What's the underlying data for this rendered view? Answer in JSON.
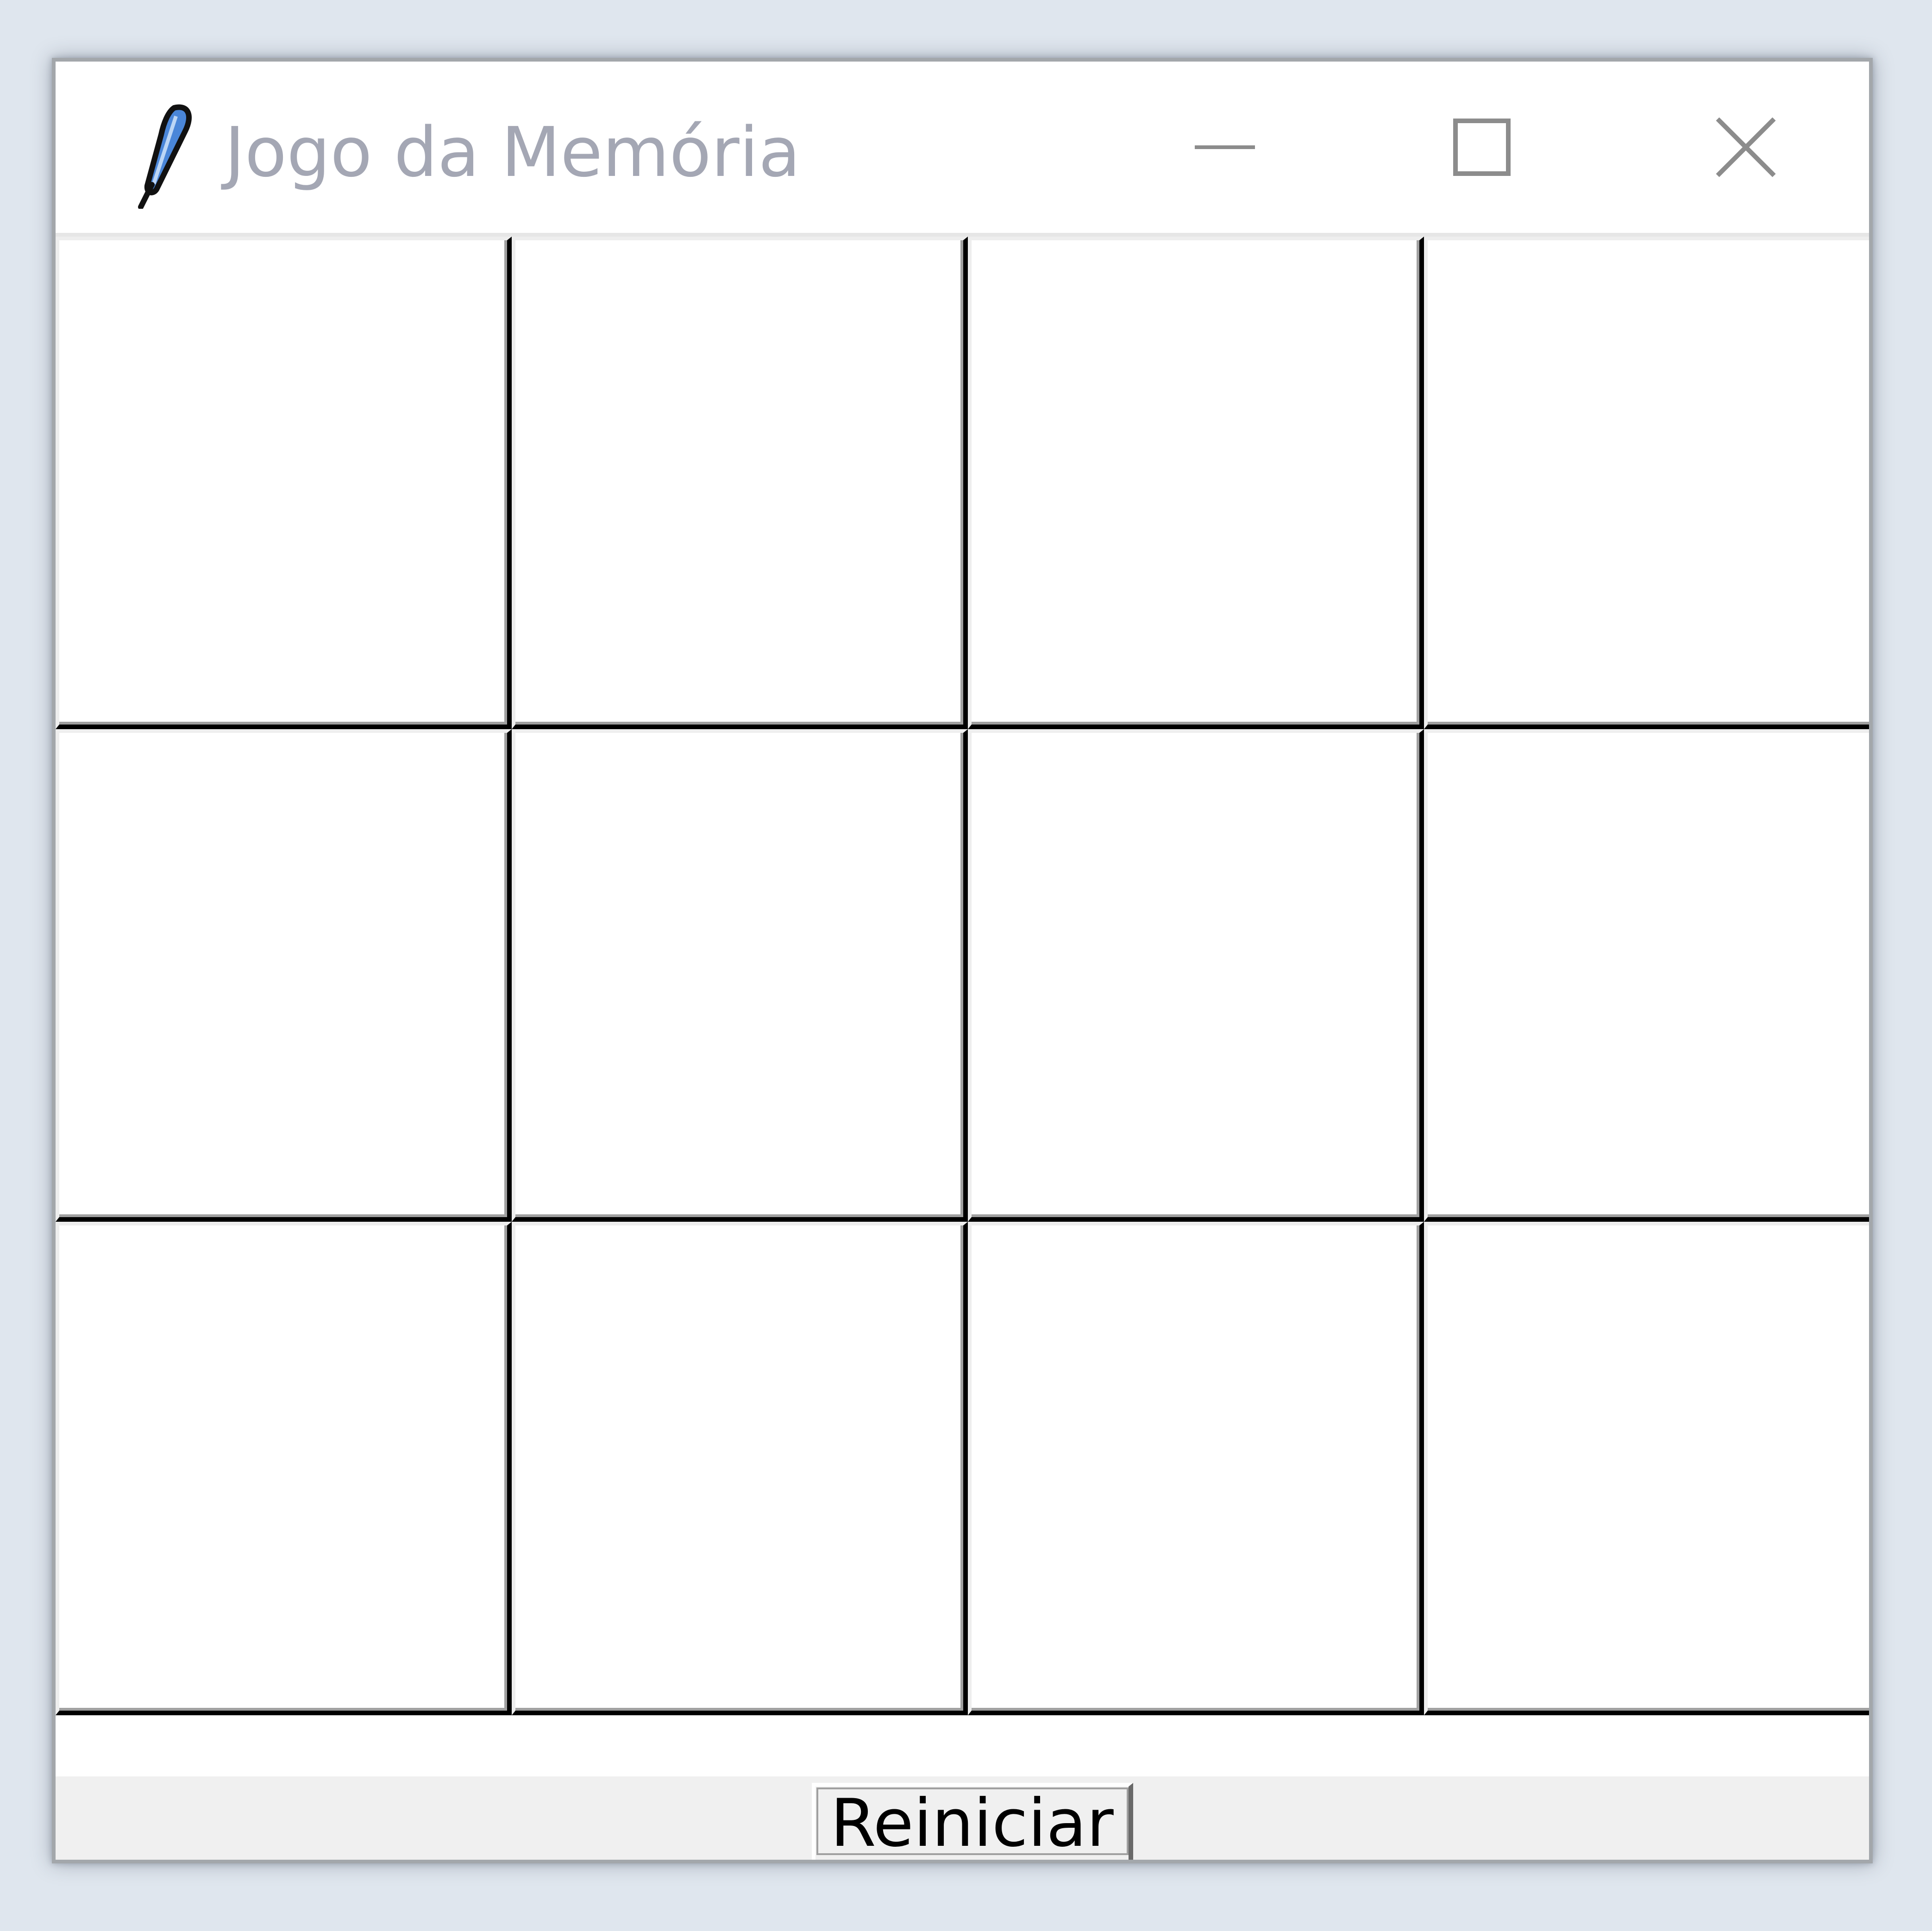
{
  "window": {
    "title": "Jogo da Memória",
    "icon": "feather-icon",
    "controls": {
      "minimize_icon": "minimize-icon",
      "maximize_icon": "maximize-icon",
      "close_icon": "close-icon"
    }
  },
  "board": {
    "rows": 3,
    "columns": 4,
    "cards": [
      {
        "label": ""
      },
      {
        "label": ""
      },
      {
        "label": ""
      },
      {
        "label": ""
      },
      {
        "label": ""
      },
      {
        "label": ""
      },
      {
        "label": ""
      },
      {
        "label": ""
      },
      {
        "label": ""
      },
      {
        "label": ""
      },
      {
        "label": ""
      },
      {
        "label": ""
      }
    ]
  },
  "controls": {
    "restart_label": "Reiniciar"
  },
  "colors": {
    "desktop": "#dfe6ee",
    "title_text": "#a4a7b4",
    "card_face": "#ffffff",
    "grid_line": "#000000",
    "bottom_bar": "#f0f0f0",
    "feather_accent": "#4a86d8"
  }
}
